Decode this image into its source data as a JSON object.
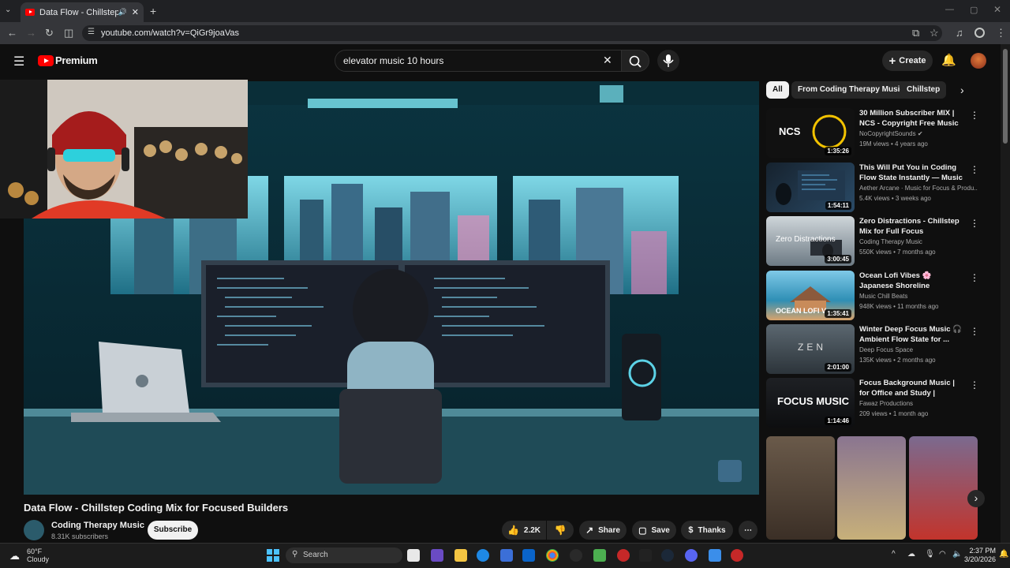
{
  "browser": {
    "tab_title": "Data Flow - Chillstep Coding",
    "url": "youtube.com/watch?v=QiGr9joaVas"
  },
  "header": {
    "logo_text": "Premium",
    "search_value": "elevator music 10 hours",
    "create_label": "Create"
  },
  "chips": [
    "All",
    "From Coding Therapy Music",
    "Chillstep"
  ],
  "video": {
    "title": "Data Flow - Chillstep Coding Mix for Focused Builders",
    "channel": "Coding Therapy Music",
    "subscribers": "8.31K subscribers",
    "subscribe_label": "Subscribe",
    "likes": "2.2K",
    "share_label": "Share",
    "save_label": "Save",
    "thanks_label": "Thanks"
  },
  "recommendations": [
    {
      "title": "30 Million Subscriber MIX | NCS - Copyright Free Music",
      "channel": "NoCopyrightSounds",
      "meta": "19M views • 4 years ago",
      "duration": "1:35:26",
      "thumb_text": "NCS"
    },
    {
      "title": "This Will Put You in Coding Flow State Instantly — Music for ...",
      "channel": "Aether Arcane · Music for Focus & Produ...",
      "meta": "5.4K views • 3 weeks ago",
      "duration": "1:54:11",
      "thumb_text": ""
    },
    {
      "title": "Zero Distractions - Chillstep Mix for Full Focus",
      "channel": "Coding Therapy Music",
      "meta": "550K views • 7 months ago",
      "duration": "3:00:45",
      "thumb_text": "Zero Distractions"
    },
    {
      "title": "Ocean Lofi Vibes 🌸 Japanese Shoreline Ambience with ...",
      "channel": "Music Chill Beats",
      "meta": "948K views • 11 months ago",
      "duration": "1:35:41",
      "thumb_text": "OCEAN LOFI V"
    },
    {
      "title": "Winter Deep Focus Music 🎧 Ambient Flow State for ...",
      "channel": "Deep Focus Space",
      "meta": "135K views • 2 months ago",
      "duration": "2:01:00",
      "thumb_text": "ZEN"
    },
    {
      "title": "Focus Background Music | for Office and Study | Ambient ...",
      "channel": "Fawaz Productions",
      "meta": "209 views • 1 month ago",
      "duration": "1:14:46",
      "thumb_text": "FOCUS MUSIC"
    }
  ],
  "taskbar": {
    "temp": "60°F",
    "weather": "Cloudy",
    "search_placeholder": "Search",
    "time": "2:37 PM",
    "date": "3/20/2026"
  },
  "colors": {
    "brand": "#ff0000",
    "background": "#0f0f0f",
    "chip": "#272727"
  }
}
